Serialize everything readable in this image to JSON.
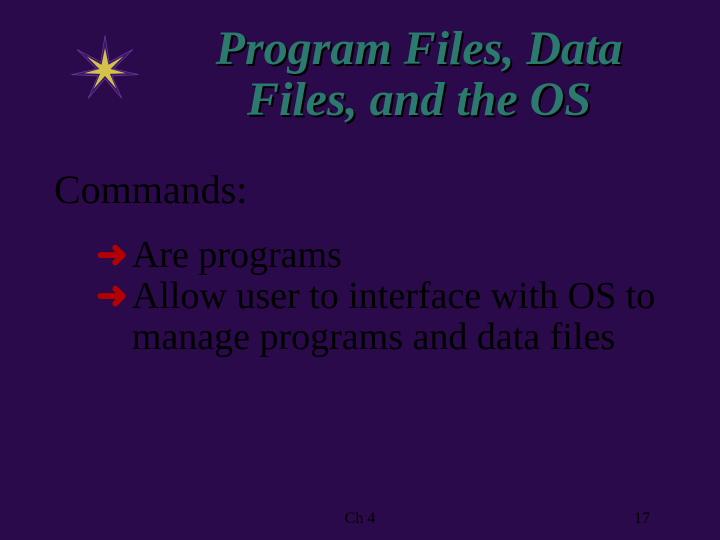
{
  "title": "Program Files, Data Files, and the OS",
  "subheading": "Commands:",
  "bullets": [
    "Are programs",
    "Allow user to interface with OS to manage programs and data files"
  ],
  "footer": {
    "center": "Ch 4",
    "right": "17"
  },
  "colors": {
    "background": "#2a0a4a",
    "title": "#2b7a6f",
    "arrow": "#b30000"
  }
}
